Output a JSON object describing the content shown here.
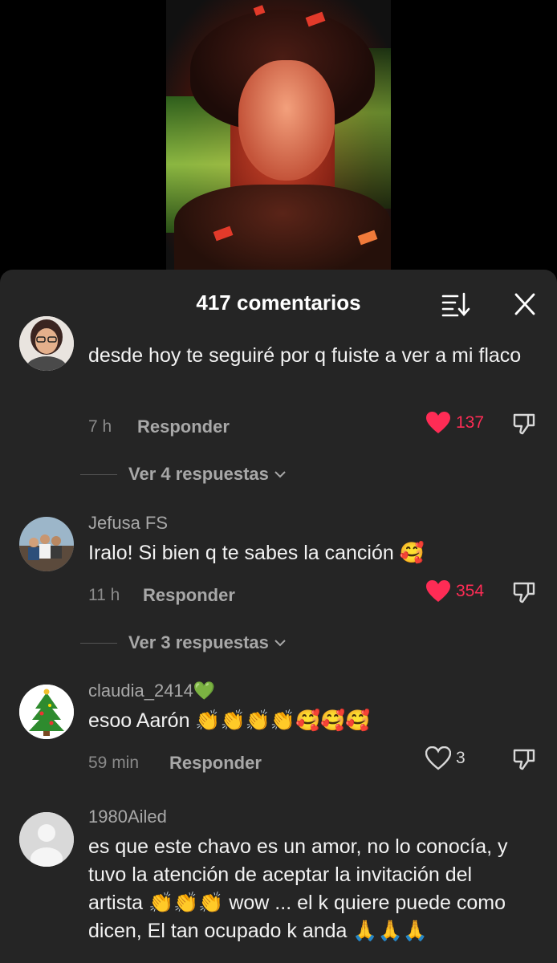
{
  "header": {
    "title": "417 comentarios"
  },
  "icons": {
    "sort": "sort-icon",
    "close": "close-icon",
    "like": "heart-icon",
    "dislike": "thumbs-down-icon",
    "chevron": "chevron-down-icon"
  },
  "colors": {
    "sheet_bg": "#252525",
    "like_red": "#fe2c55",
    "text": "#f2f2f2",
    "muted": "#a8a8a8"
  },
  "comments": [
    {
      "username": "",
      "text": "desde hoy te seguiré por q fuiste a ver a mi flaco",
      "time": "7 h",
      "reply_label": "Responder",
      "likes": "137",
      "liked": true,
      "view_replies": "Ver 4 respuestas"
    },
    {
      "username": "Jefusa FS",
      "text": "Iralo! Si bien q te sabes la canción 🥰",
      "time": "11 h",
      "reply_label": "Responder",
      "likes": "354",
      "liked": true,
      "view_replies": "Ver 3 respuestas"
    },
    {
      "username": "claudia_2414💚",
      "text": "esoo Aarón 👏👏👏👏🥰🥰🥰",
      "time": "59 min",
      "reply_label": "Responder",
      "likes": "3",
      "liked": false
    },
    {
      "username": "1980Ailed",
      "text": "es que este chavo es un amor, no lo conocía, y tuvo la atención de aceptar la invitación del artista 👏👏👏 wow ... el k quiere puede como dicen, El tan ocupado k anda 🙏🙏🙏"
    }
  ]
}
